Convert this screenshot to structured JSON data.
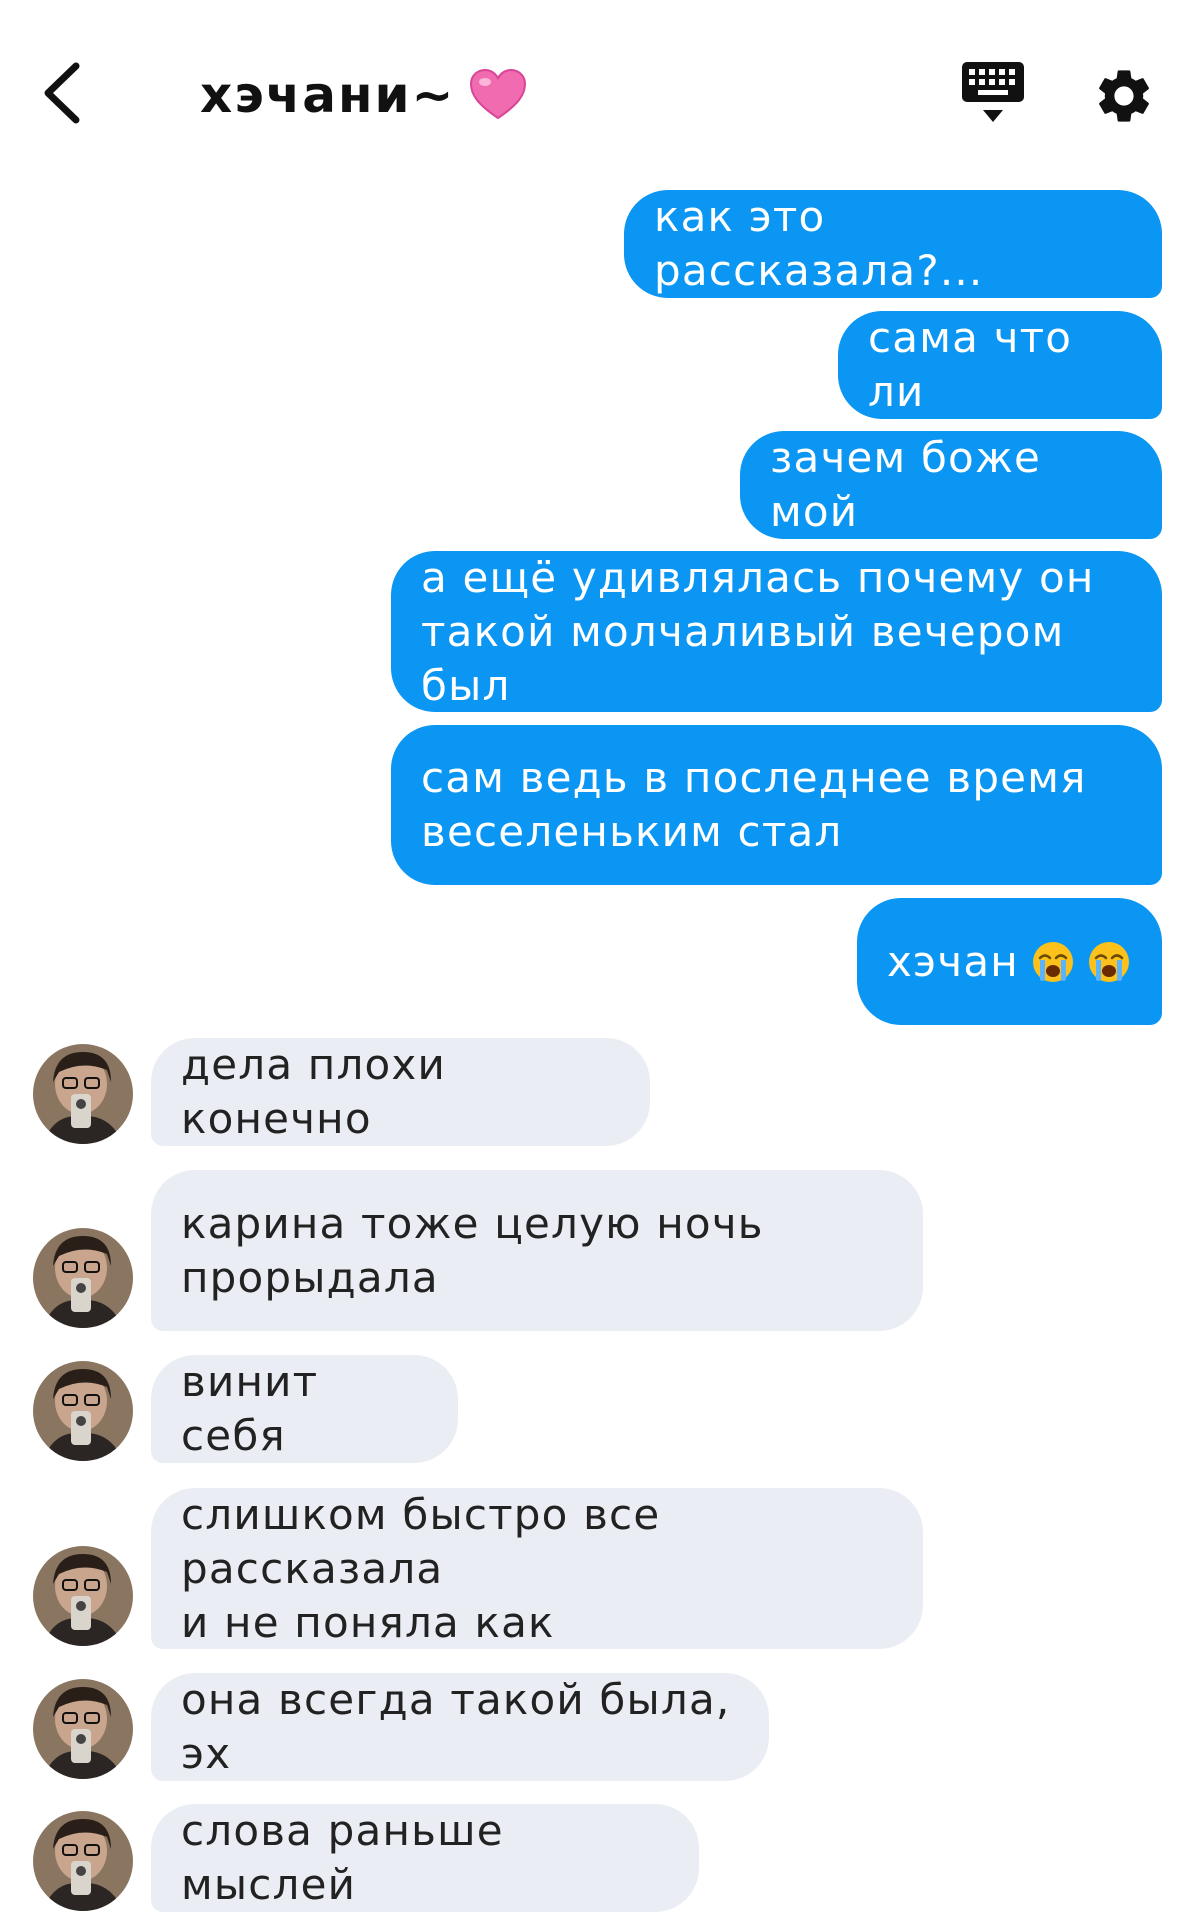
{
  "header": {
    "contact_name": "хэчани~",
    "icons": {
      "back": "chevron-left-icon",
      "heart": "pink-heart-icon",
      "keyboard": "keyboard-hide-icon",
      "settings": "gear-icon"
    },
    "accent_color": "#0a96f2"
  },
  "messages": {
    "outgoing": [
      {
        "text": "как это рассказала?..."
      },
      {
        "text": "сама что ли"
      },
      {
        "text": "зачем боже мой"
      },
      {
        "text": "а ещё удивлялась почему он\nтакой молчаливый вечером был"
      },
      {
        "text": "сам ведь в последнее время\nвеселеньким стал"
      },
      {
        "text": "хэчан",
        "emoji": [
          "crying-face-icon",
          "crying-face-icon"
        ]
      }
    ],
    "incoming": [
      {
        "text": "дела плохи конечно"
      },
      {
        "text": "карина тоже целую ночь\nпрорыдала"
      },
      {
        "text": "винит себя"
      },
      {
        "text": "слишком быстро все рассказала\nи не поняла как"
      },
      {
        "text": "она всегда такой была, эх"
      },
      {
        "text": "слова раньше мыслей"
      }
    ]
  }
}
